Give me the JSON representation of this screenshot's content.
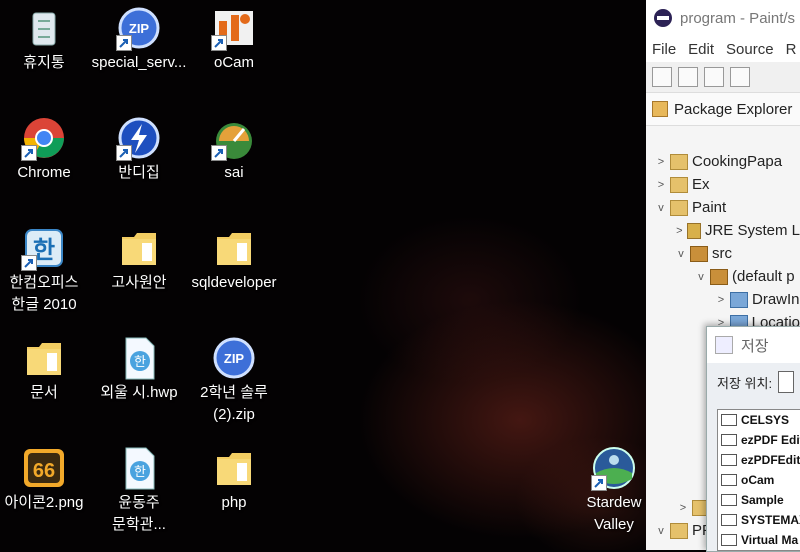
{
  "desktop": {
    "icons": [
      {
        "label": "휴지통",
        "icon": "recycle-bin-icon"
      },
      {
        "label": "special_serv...",
        "icon": "zip-archive-icon"
      },
      {
        "label": "oCam",
        "icon": "ocam-icon"
      },
      {
        "label": "Chrome",
        "icon": "chrome-icon"
      },
      {
        "label": "반디집",
        "icon": "bandizip-icon"
      },
      {
        "label": "sai",
        "icon": "sai-icon"
      },
      {
        "label": "한컴오피스\n한글 2010",
        "icon": "hwp-app-icon"
      },
      {
        "label": "고사원안",
        "icon": "folder-icon"
      },
      {
        "label": "sqldeveloper",
        "icon": "folder-icon"
      },
      {
        "label": "문서",
        "icon": "folder-icon"
      },
      {
        "label": "외울 시.hwp",
        "icon": "hwp-document-icon"
      },
      {
        "label": "2학년 솔루\n(2).zip",
        "icon": "zip-archive-icon"
      },
      {
        "label": "아이콘2.png",
        "icon": "png-image-icon"
      },
      {
        "label": "윤동주\n문학관...",
        "icon": "hwp-document-icon"
      },
      {
        "label": "php",
        "icon": "folder-icon"
      },
      {
        "label": "Stardew\nValley",
        "icon": "stardew-valley-icon"
      }
    ]
  },
  "eclipse": {
    "title": "program - Paint/s",
    "menu": [
      "File",
      "Edit",
      "Source",
      "R"
    ],
    "view_title": "Package Explorer",
    "tree": [
      {
        "label": "CookingPapa",
        "arrow": ">",
        "indent": 0,
        "icon": "project"
      },
      {
        "label": "Ex",
        "arrow": ">",
        "indent": 0,
        "icon": "project"
      },
      {
        "label": "Paint",
        "arrow": "v",
        "indent": 0,
        "icon": "project"
      },
      {
        "label": "JRE System L",
        "arrow": ">",
        "indent": 1,
        "icon": "library"
      },
      {
        "label": "src",
        "arrow": "v",
        "indent": 1,
        "icon": "package"
      },
      {
        "label": "(default p",
        "arrow": "v",
        "indent": 2,
        "icon": "package"
      },
      {
        "label": "DrawIn",
        "arrow": ">",
        "indent": 3,
        "icon": "java-file"
      },
      {
        "label": "Locatio",
        "arrow": ">",
        "indent": 3,
        "icon": "java-file"
      }
    ],
    "tree_bottom": [
      {
        "label": "",
        "arrow": ">"
      },
      {
        "label": "PF",
        "arrow": "v"
      }
    ]
  },
  "save_dialog": {
    "title": "저장",
    "location_label": "저장 위치:",
    "folders": [
      "CELSYS",
      "ezPDF Edit",
      "ezPDFEdito",
      "oCam",
      "Sample",
      "SYSTEMAX",
      "Virtual Ma"
    ]
  }
}
